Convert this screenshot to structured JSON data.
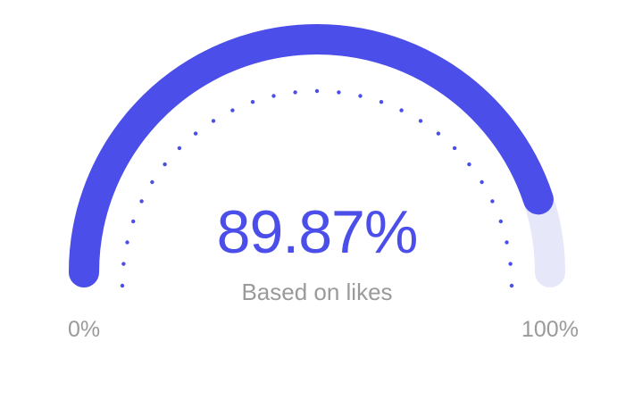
{
  "gauge": {
    "value_percent": 89.87,
    "value_text": "89.87%",
    "caption": "Based on likes",
    "min_label": "0%",
    "max_label": "100%"
  },
  "colors": {
    "accent": "#4b4ee8",
    "track": "#e7e7fa",
    "caption": "#9a9a9a"
  }
}
